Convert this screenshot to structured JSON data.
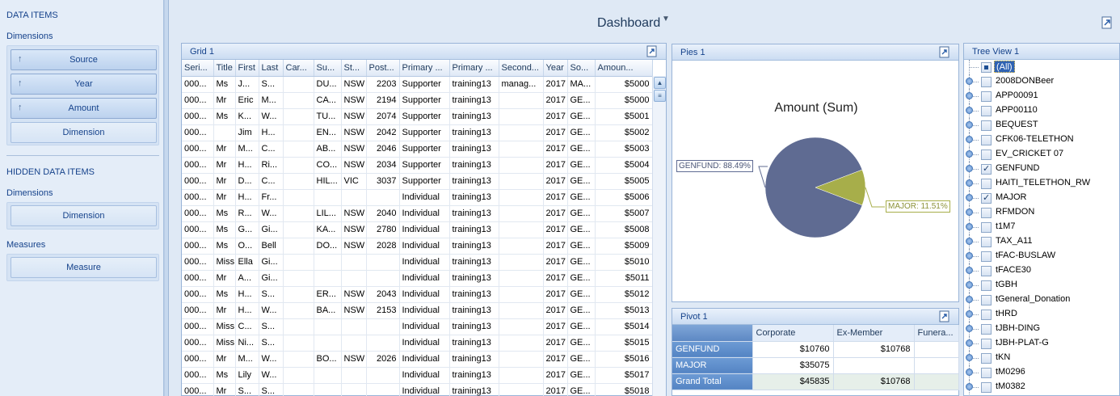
{
  "left_panel": {
    "data_items_title": "DATA ITEMS",
    "dimensions_label": "Dimensions",
    "dimension_items": [
      {
        "label": "Source",
        "sort_icon": "sort-up-arrow-icon"
      },
      {
        "label": "Year",
        "sort_icon": "sort-up-arrow-icon"
      },
      {
        "label": "Amount",
        "sort_icon": "sort-up-arrow-icon"
      }
    ],
    "add_dimension_label": "Dimension",
    "hidden_title": "HIDDEN DATA ITEMS",
    "hidden_dimensions_label": "Dimensions",
    "hidden_dimension_button": "Dimension",
    "measures_label": "Measures",
    "measure_button": "Measure"
  },
  "dashboard": {
    "title": "Dashboard",
    "filter_icon": "filter-icon",
    "export_icon": "export-icon"
  },
  "grid": {
    "title": "Grid 1",
    "columns": [
      "Seri...",
      "Title",
      "First",
      "Last",
      "Car...",
      "Su...",
      "St...",
      "Post...",
      "Primary ...",
      "Primary ...",
      "Second...",
      "Year",
      "So...",
      "Amoun..."
    ],
    "rows": [
      [
        "000...",
        "Ms",
        "J...",
        "S...",
        "",
        "DU...",
        "NSW",
        "2203",
        "Supporter",
        "training13",
        "manag...",
        "2017",
        "MA...",
        "$5000"
      ],
      [
        "000...",
        "Mr",
        "Eric",
        "M...",
        "",
        "CA...",
        "NSW",
        "2194",
        "Supporter",
        "training13",
        "",
        "2017",
        "GE...",
        "$5000"
      ],
      [
        "000...",
        "Ms",
        "K...",
        "W...",
        "",
        "TU...",
        "NSW",
        "2074",
        "Supporter",
        "training13",
        "",
        "2017",
        "GE...",
        "$5001"
      ],
      [
        "000...",
        "",
        "Jim",
        "H...",
        "",
        "EN...",
        "NSW",
        "2042",
        "Supporter",
        "training13",
        "",
        "2017",
        "GE...",
        "$5002"
      ],
      [
        "000...",
        "Mr",
        "M...",
        "C...",
        "",
        "AB...",
        "NSW",
        "2046",
        "Supporter",
        "training13",
        "",
        "2017",
        "GE...",
        "$5003"
      ],
      [
        "000...",
        "Mr",
        "H...",
        "Ri...",
        "",
        "CO...",
        "NSW",
        "2034",
        "Supporter",
        "training13",
        "",
        "2017",
        "GE...",
        "$5004"
      ],
      [
        "000...",
        "Mr",
        "D...",
        "C...",
        "",
        "HIL...",
        "VIC",
        "3037",
        "Supporter",
        "training13",
        "",
        "2017",
        "GE...",
        "$5005"
      ],
      [
        "000...",
        "Mr",
        "H...",
        "Fr...",
        "",
        "",
        "",
        "",
        "Individual",
        "training13",
        "",
        "2017",
        "GE...",
        "$5006"
      ],
      [
        "000...",
        "Ms",
        "R...",
        "W...",
        "",
        "LIL...",
        "NSW",
        "2040",
        "Individual",
        "training13",
        "",
        "2017",
        "GE...",
        "$5007"
      ],
      [
        "000...",
        "Ms",
        "G...",
        "Gi...",
        "",
        "KA...",
        "NSW",
        "2780",
        "Individual",
        "training13",
        "",
        "2017",
        "GE...",
        "$5008"
      ],
      [
        "000...",
        "Ms",
        "O...",
        "Bell",
        "",
        "DO...",
        "NSW",
        "2028",
        "Individual",
        "training13",
        "",
        "2017",
        "GE...",
        "$5009"
      ],
      [
        "000...",
        "Miss",
        "Ella",
        "Gi...",
        "",
        "",
        "",
        "",
        "Individual",
        "training13",
        "",
        "2017",
        "GE...",
        "$5010"
      ],
      [
        "000...",
        "Mr",
        "A...",
        "Gi...",
        "",
        "",
        "",
        "",
        "Individual",
        "training13",
        "",
        "2017",
        "GE...",
        "$5011"
      ],
      [
        "000...",
        "Ms",
        "H...",
        "S...",
        "",
        "ER...",
        "NSW",
        "2043",
        "Individual",
        "training13",
        "",
        "2017",
        "GE...",
        "$5012"
      ],
      [
        "000...",
        "Mr",
        "H...",
        "W...",
        "",
        "BA...",
        "NSW",
        "2153",
        "Individual",
        "training13",
        "",
        "2017",
        "GE...",
        "$5013"
      ],
      [
        "000...",
        "Miss",
        "C...",
        "S...",
        "",
        "",
        "",
        "",
        "Individual",
        "training13",
        "",
        "2017",
        "GE...",
        "$5014"
      ],
      [
        "000...",
        "Miss",
        "Ni...",
        "S...",
        "",
        "",
        "",
        "",
        "Individual",
        "training13",
        "",
        "2017",
        "GE...",
        "$5015"
      ],
      [
        "000...",
        "Mr",
        "M...",
        "W...",
        "",
        "BO...",
        "NSW",
        "2026",
        "Individual",
        "training13",
        "",
        "2017",
        "GE...",
        "$5016"
      ],
      [
        "000...",
        "Ms",
        "Lily",
        "W...",
        "",
        "",
        "",
        "",
        "Individual",
        "training13",
        "",
        "2017",
        "GE...",
        "$5017"
      ],
      [
        "000...",
        "Mr",
        "S...",
        "S...",
        "",
        "",
        "",
        "",
        "Individual",
        "training13",
        "",
        "2017",
        "GE...",
        "$5018"
      ]
    ]
  },
  "pies": {
    "title": "Pies 1"
  },
  "chart_data": {
    "type": "pie",
    "title": "Amount (Sum)",
    "categories": [
      "GENFUND",
      "MAJOR"
    ],
    "values": [
      88.49,
      11.51
    ],
    "labels": [
      "GENFUND: 88.49%",
      "MAJOR: 11.51%"
    ],
    "colors": [
      "#5f6b92",
      "#a7ae4a"
    ]
  },
  "pivot": {
    "title": "Pivot 1",
    "columns": [
      "Corporate",
      "Ex-Member",
      "Funera..."
    ],
    "rows": [
      {
        "label": "GENFUND",
        "values": [
          "$10760",
          "$10768",
          ""
        ]
      },
      {
        "label": "MAJOR",
        "values": [
          "$35075",
          "",
          ""
        ]
      },
      {
        "label": "Grand Total",
        "values": [
          "$45835",
          "$10768",
          ""
        ]
      }
    ]
  },
  "tree": {
    "title": "Tree View 1",
    "items": [
      {
        "label": "(All)",
        "state": "partial",
        "selected": true
      },
      {
        "label": "2008DONBeer",
        "state": "unchecked"
      },
      {
        "label": "APP00091",
        "state": "unchecked"
      },
      {
        "label": "APP00110",
        "state": "unchecked"
      },
      {
        "label": "BEQUEST",
        "state": "unchecked"
      },
      {
        "label": "CFK06-TELETHON",
        "state": "unchecked"
      },
      {
        "label": "EV_CRICKET 07",
        "state": "unchecked"
      },
      {
        "label": "GENFUND",
        "state": "checked"
      },
      {
        "label": "HAITI_TELETHON_RW",
        "state": "unchecked"
      },
      {
        "label": "MAJOR",
        "state": "checked"
      },
      {
        "label": "RFMDON",
        "state": "unchecked"
      },
      {
        "label": "t1M7",
        "state": "unchecked"
      },
      {
        "label": "TAX_A11",
        "state": "unchecked"
      },
      {
        "label": "tFAC-BUSLAW",
        "state": "unchecked"
      },
      {
        "label": "tFACE30",
        "state": "unchecked"
      },
      {
        "label": "tGBH",
        "state": "unchecked"
      },
      {
        "label": "tGeneral_Donation",
        "state": "unchecked"
      },
      {
        "label": "tHRD",
        "state": "unchecked"
      },
      {
        "label": "tJBH-DING",
        "state": "unchecked"
      },
      {
        "label": "tJBH-PLAT-G",
        "state": "unchecked"
      },
      {
        "label": "tKN",
        "state": "unchecked"
      },
      {
        "label": "tM0296",
        "state": "unchecked"
      },
      {
        "label": "tM0382",
        "state": "unchecked"
      }
    ]
  }
}
